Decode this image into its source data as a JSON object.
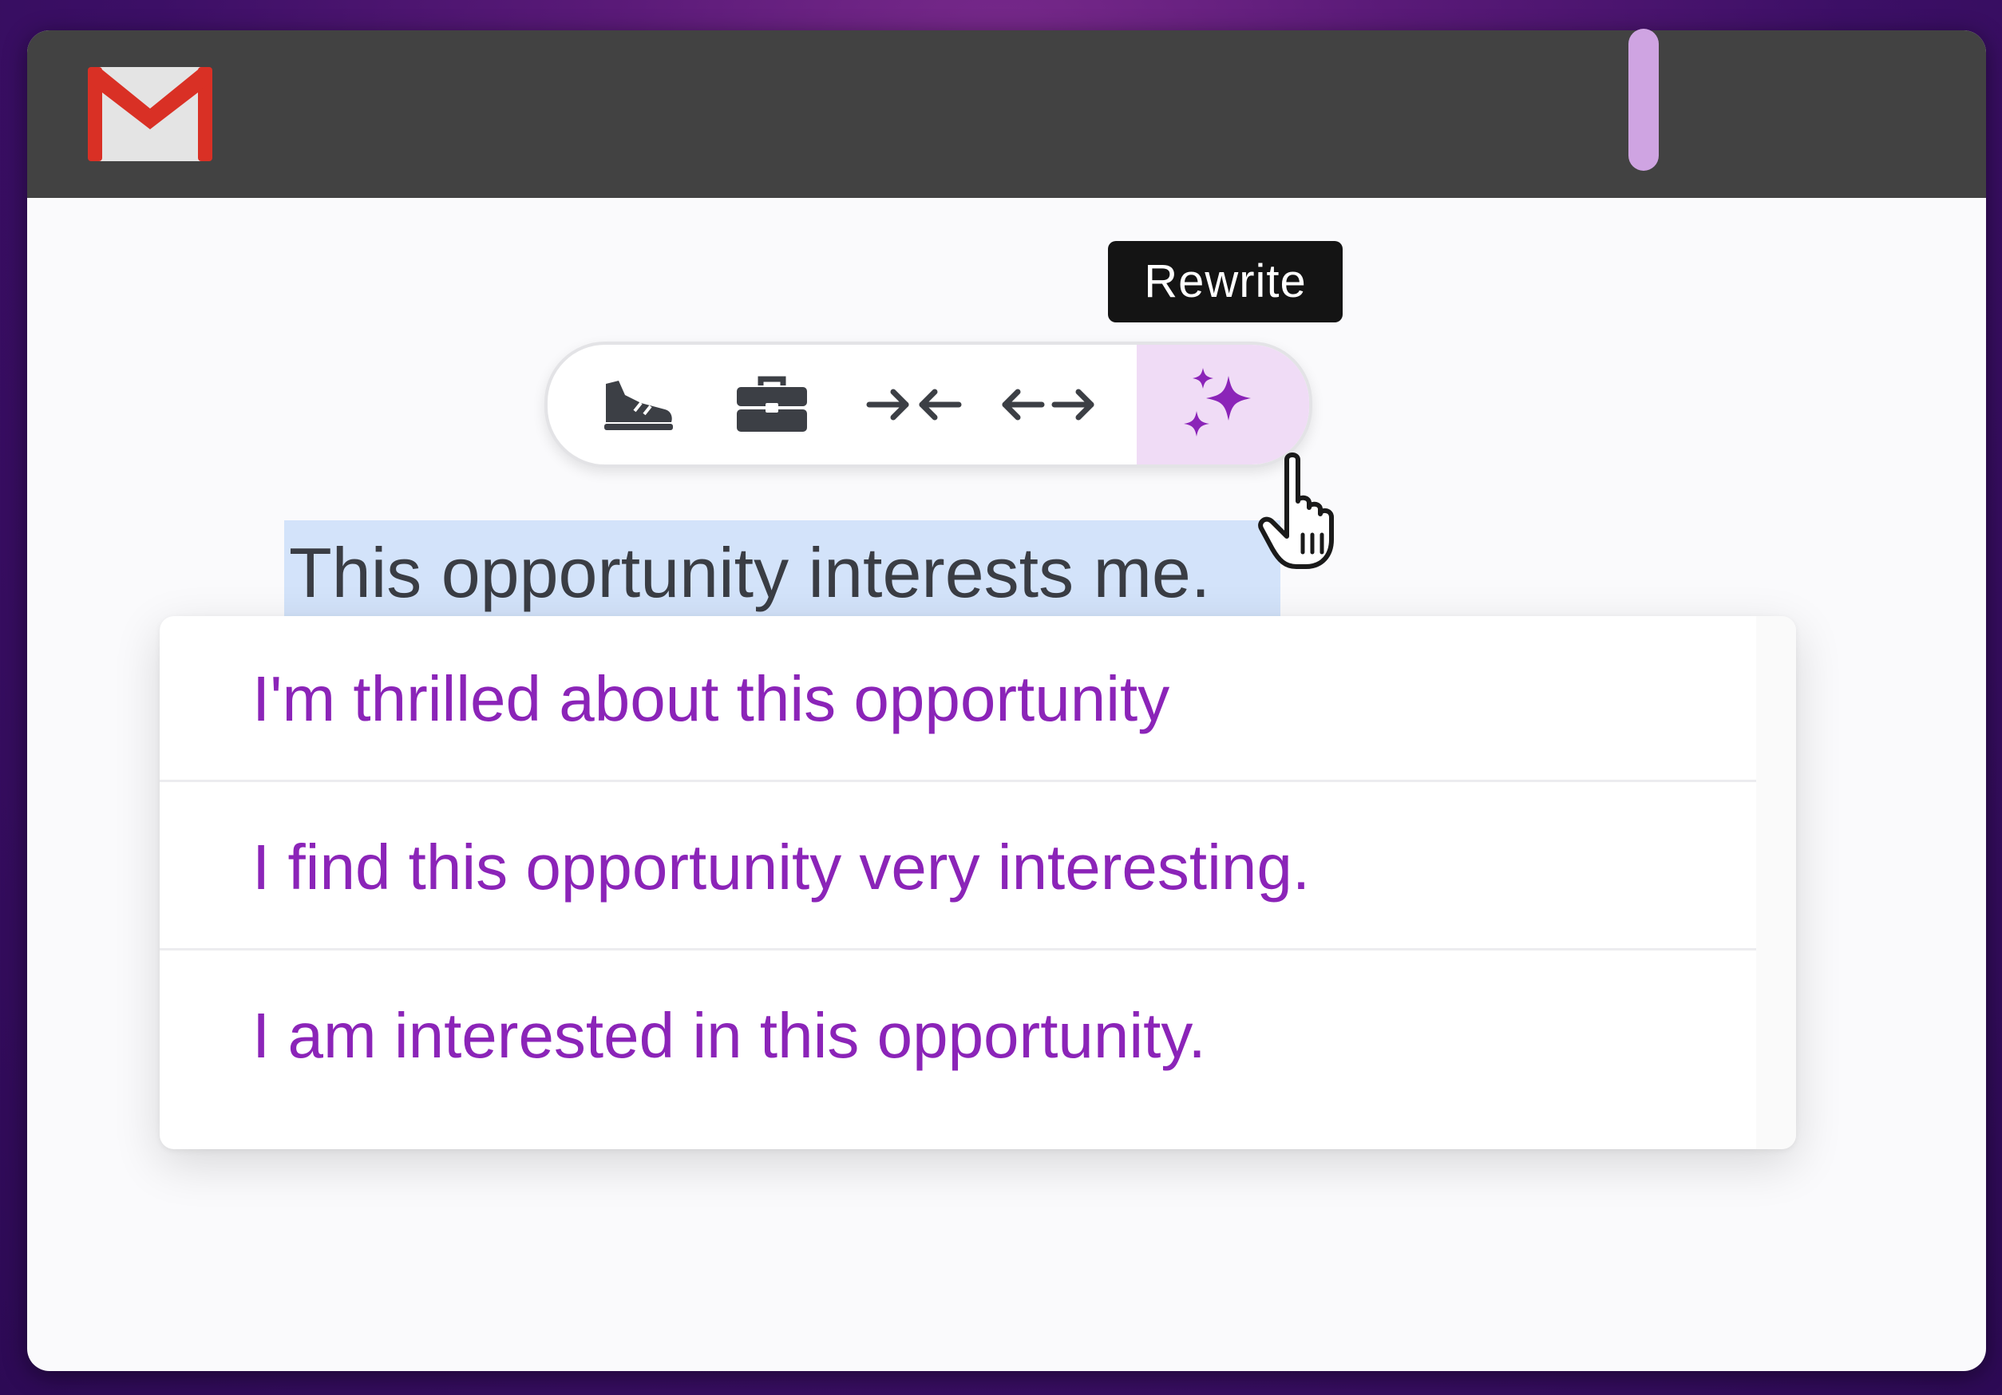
{
  "app": {
    "logo_icon": "gmail-logo",
    "brand_colors": {
      "red": "#d93025",
      "light_gray": "#e6e6e6",
      "dark_gray": "#b3b3b3"
    }
  },
  "tooltip": {
    "text": "Rewrite"
  },
  "toolbar": {
    "tools": [
      {
        "id": "casual",
        "icon": "sneaker-icon"
      },
      {
        "id": "formal",
        "icon": "briefcase-icon"
      },
      {
        "id": "shorten",
        "icon": "arrows-inward-icon"
      },
      {
        "id": "elaborate",
        "icon": "arrows-outward-icon"
      },
      {
        "id": "rewrite",
        "icon": "sparkle-icon",
        "active": true
      }
    ],
    "active_bg": "#f0dcf6",
    "sparkle_color": "#8b24b8"
  },
  "editor": {
    "selected_text": "This opportunity interests me.",
    "selection_color": "#d3e3fa"
  },
  "suggestions": {
    "items": [
      "I'm thrilled about this opportunity",
      "I find this opportunity very interesting.",
      "I am interested in this opportunity."
    ],
    "text_color": "#8b24b8",
    "scroll_thumb_color": "#cfa4e2"
  }
}
